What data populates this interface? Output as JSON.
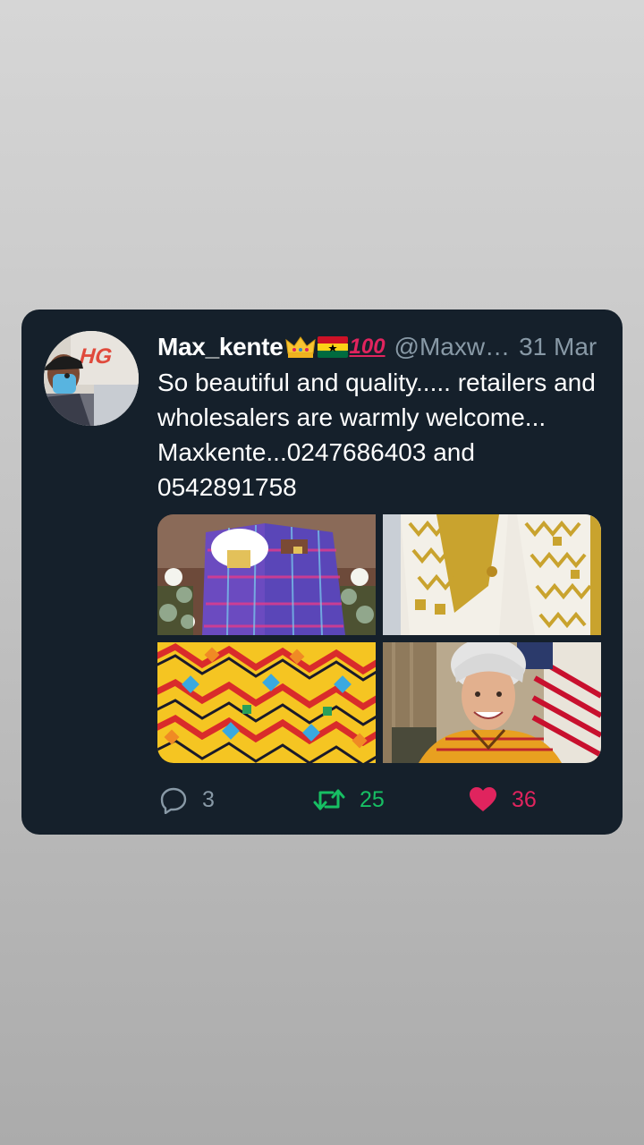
{
  "tweet": {
    "author": {
      "display_name": "Max_kente",
      "badge_100": "100",
      "handle": "@Maxw…",
      "avatar_icon": "profile-photo"
    },
    "date": "31 Mar",
    "text": "So beautiful and quality..... retailers and wholesalers are warmly welcome... Maxkente...0247686403 and 0542891758",
    "media": [
      {
        "icon": "kente-couple-photo"
      },
      {
        "icon": "gold-kente-fabric-photo"
      },
      {
        "icon": "colorful-kente-fabric-photo"
      },
      {
        "icon": "woman-in-kente-photo"
      }
    ],
    "actions": {
      "replies": "3",
      "retweets": "25",
      "likes": "36"
    }
  },
  "colors": {
    "card_bg": "#15202b",
    "secondary_text": "#8899a6",
    "retweet_green": "#17bf63",
    "like_pink": "#e0245e"
  }
}
